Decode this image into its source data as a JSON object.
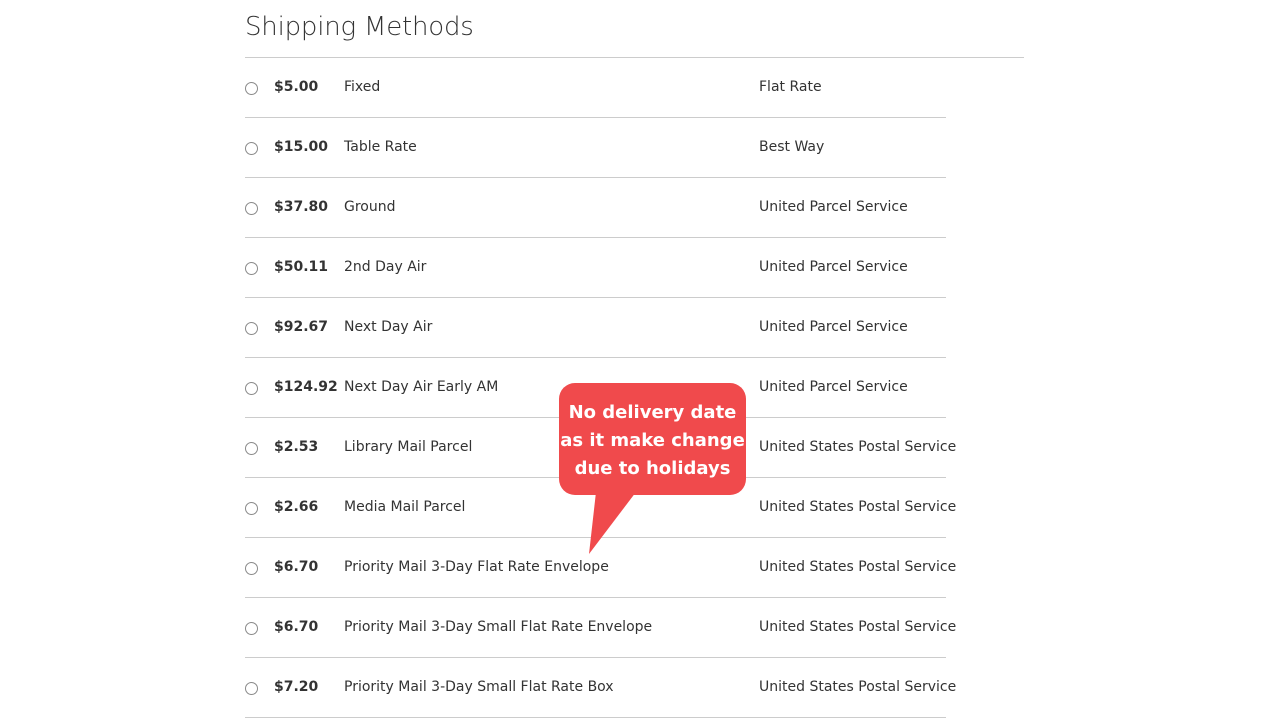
{
  "shipping": {
    "title": "Shipping Methods",
    "methods": [
      {
        "price": "$5.00",
        "method": "Fixed",
        "carrier": "Flat Rate"
      },
      {
        "price": "$15.00",
        "method": "Table Rate",
        "carrier": "Best Way"
      },
      {
        "price": "$37.80",
        "method": "Ground",
        "carrier": "United Parcel Service"
      },
      {
        "price": "$50.11",
        "method": "2nd Day Air",
        "carrier": "United Parcel Service"
      },
      {
        "price": "$92.67",
        "method": "Next Day Air",
        "carrier": "United Parcel Service"
      },
      {
        "price": "$124.92",
        "method": "Next Day Air Early AM",
        "carrier": "United Parcel Service"
      },
      {
        "price": "$2.53",
        "method": "Library Mail Parcel",
        "carrier": "United States Postal Service"
      },
      {
        "price": "$2.66",
        "method": "Media Mail Parcel",
        "carrier": "United States Postal Service"
      },
      {
        "price": "$6.70",
        "method": "Priority Mail 3-Day Flat Rate Envelope",
        "carrier": "United States Postal Service"
      },
      {
        "price": "$6.70",
        "method": "Priority Mail 3-Day Small Flat Rate Envelope",
        "carrier": "United States Postal Service"
      },
      {
        "price": "$7.20",
        "method": "Priority Mail 3-Day Small Flat Rate Box",
        "carrier": "United States Postal Service"
      }
    ]
  },
  "callout": {
    "lines": [
      "No delivery date",
      "as it make change",
      "due to holidays"
    ],
    "color": "#f04a4c"
  },
  "colors": {
    "divider": "#cccccc",
    "text": "#333333"
  }
}
